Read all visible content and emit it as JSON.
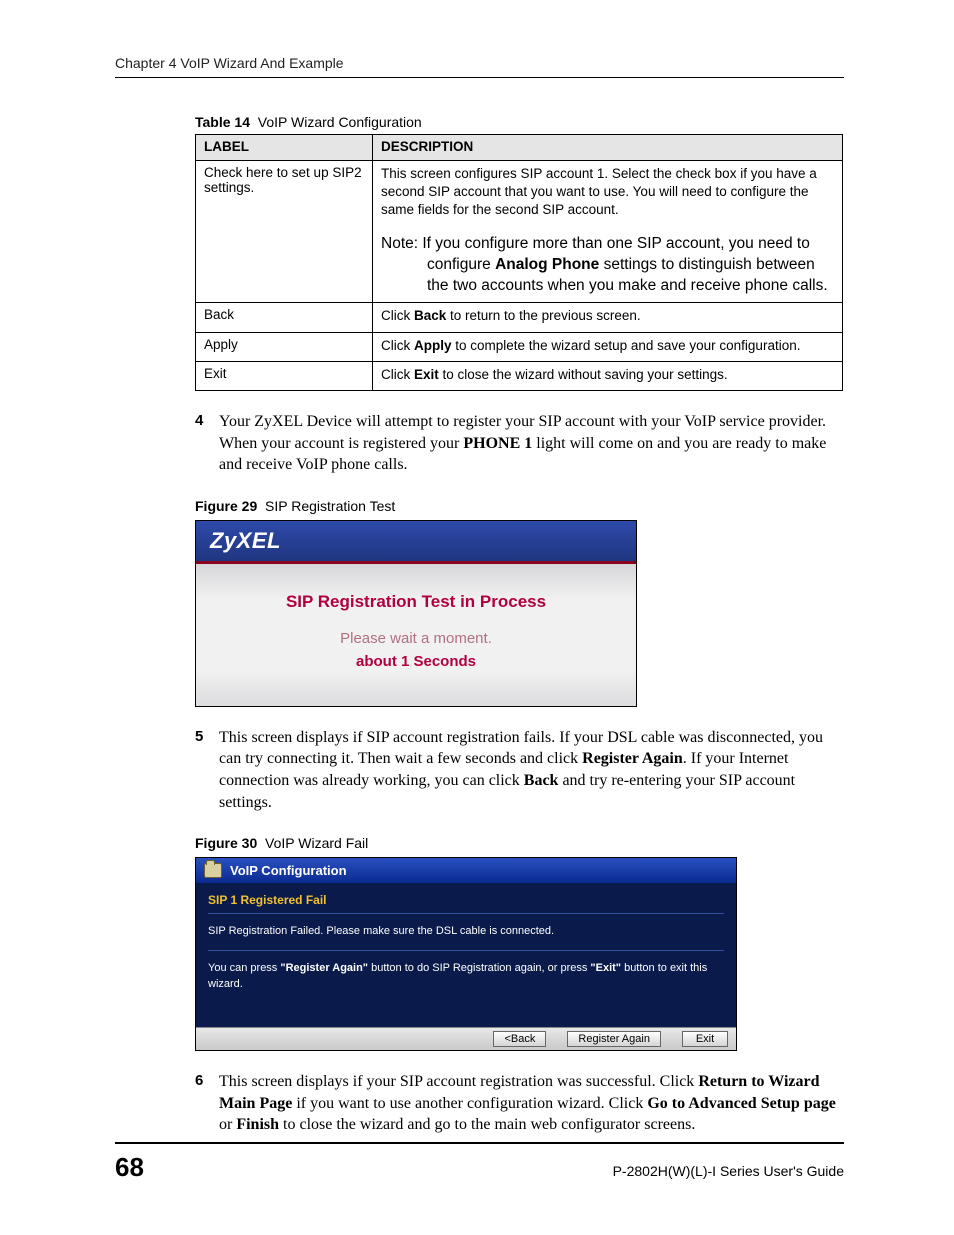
{
  "header": {
    "chapter": "Chapter 4 VoIP Wizard And Example"
  },
  "table": {
    "caption_num": "Table 14",
    "caption_text": "VoIP Wizard Configuration",
    "head": {
      "label": "LABEL",
      "desc": "DESCRIPTION"
    },
    "rows": [
      {
        "label": "Check here to set up SIP2 settings.",
        "desc": "This screen configures SIP account 1. Select the check box if you have a second SIP account that you want to use. You will need to configure the same fields for the second SIP account.",
        "note_prefix": "Note: If you configure more than one SIP account, you need to configure ",
        "note_bold": "Analog Phone",
        "note_suffix": " settings to distinguish between the two accounts when you make and receive phone calls."
      },
      {
        "label": "Back",
        "pre": "Click ",
        "bold": "Back",
        "post": " to return to the previous screen."
      },
      {
        "label": "Apply",
        "pre": "Click ",
        "bold": "Apply",
        "post": " to complete the wizard setup and save your configuration."
      },
      {
        "label": "Exit",
        "pre": "Click ",
        "bold": "Exit",
        "post": " to close the wizard without saving your settings."
      }
    ]
  },
  "step4": {
    "num": "4",
    "pre": "Your ZyXEL Device will attempt to register your SIP account with your VoIP service provider. When your account is registered your ",
    "bold": "PHONE 1",
    "post": " light will come on and you are ready to make and receive VoIP phone calls."
  },
  "fig29": {
    "cap_num": "Figure 29",
    "cap_text": "SIP Registration Test",
    "logo": "ZyXEL",
    "title": "SIP Registration Test in Process",
    "wait": "Please wait a moment.",
    "secs": "about 1 Seconds"
  },
  "step5": {
    "num": "5",
    "t1": "This screen displays if SIP account registration fails. If your DSL cable was disconnected, you can try connecting it. Then wait a few seconds and click ",
    "b1": "Register Again",
    "t2": ". If your Internet connection was already working, you can click ",
    "b2": "Back",
    "t3": " and try re-entering your SIP account settings."
  },
  "fig30": {
    "cap_num": "Figure 30",
    "cap_text": "VoIP Wizard Fail",
    "winbar": "VoIP Configuration",
    "subhead": "SIP 1 Registered Fail",
    "msg1": "SIP Registration Failed. Please make sure the DSL cable is connected.",
    "msg2_a": "You can press ",
    "msg2_q1": "\"Register Again\"",
    "msg2_b": " button to do SIP Registration again, or press ",
    "msg2_q2": "\"Exit\"",
    "msg2_c": " button to exit this wizard.",
    "btn_back": "<Back",
    "btn_again": "Register Again",
    "btn_exit": "Exit"
  },
  "step6": {
    "num": "6",
    "t1": "This screen displays if your SIP account registration was successful. Click ",
    "b1": "Return to Wizard Main Page",
    "t2": " if you want to use another configuration wizard. Click ",
    "b2": "Go to Advanced Setup page",
    "t3": " or ",
    "b3": "Finish",
    "t4": " to close the wizard and go to the main web configurator screens."
  },
  "footer": {
    "page": "68",
    "guide": "P-2802H(W)(L)-I Series User's Guide"
  }
}
